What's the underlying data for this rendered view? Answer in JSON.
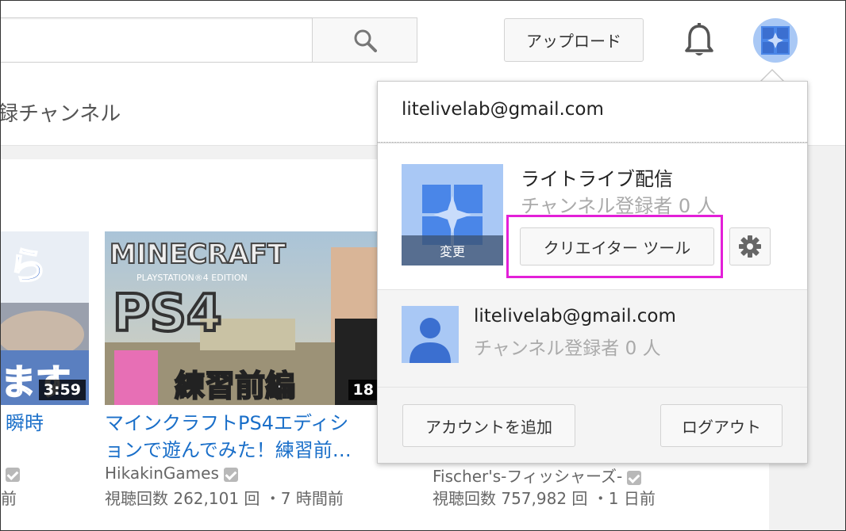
{
  "header": {
    "search_placeholder": "",
    "upload_label": "アップロード",
    "icons": {
      "search": "search-icon",
      "bell": "bell-icon",
      "avatar": "channel-avatar-icon"
    }
  },
  "subbar": {
    "label": "録チャンネル"
  },
  "videos": [
    {
      "duration": "3:59",
      "title": "瞬時",
      "channel": "",
      "meta": "前"
    },
    {
      "duration": "18",
      "thumbnail_text": "練習前編",
      "title_line1": "マインクラフトPS4エディシ",
      "title_line2": "ョンで遊んでみた！練習前…",
      "channel": "HikakinGames",
      "meta": "視聴回数 262,101 回 ・7 時間前"
    },
    {
      "channel": "Fischer's-フィッシャーズ-",
      "meta": "視聴回数 757,982 回 ・1 日前"
    }
  ],
  "dropdown": {
    "email": "litelivelab@gmail.com",
    "channel_name": "ライトライブ配信",
    "channel_subs": "チャンネル登録者 0 人",
    "change_label": "変更",
    "creator_tools_label": "クリエイター ツール",
    "second_account": {
      "email": "litelivelab@gmail.com",
      "subs": "チャンネル登録者 0 人"
    },
    "add_account_label": "アカウントを追加",
    "logout_label": "ログアウト",
    "highlight_color": "#e31fd8"
  }
}
